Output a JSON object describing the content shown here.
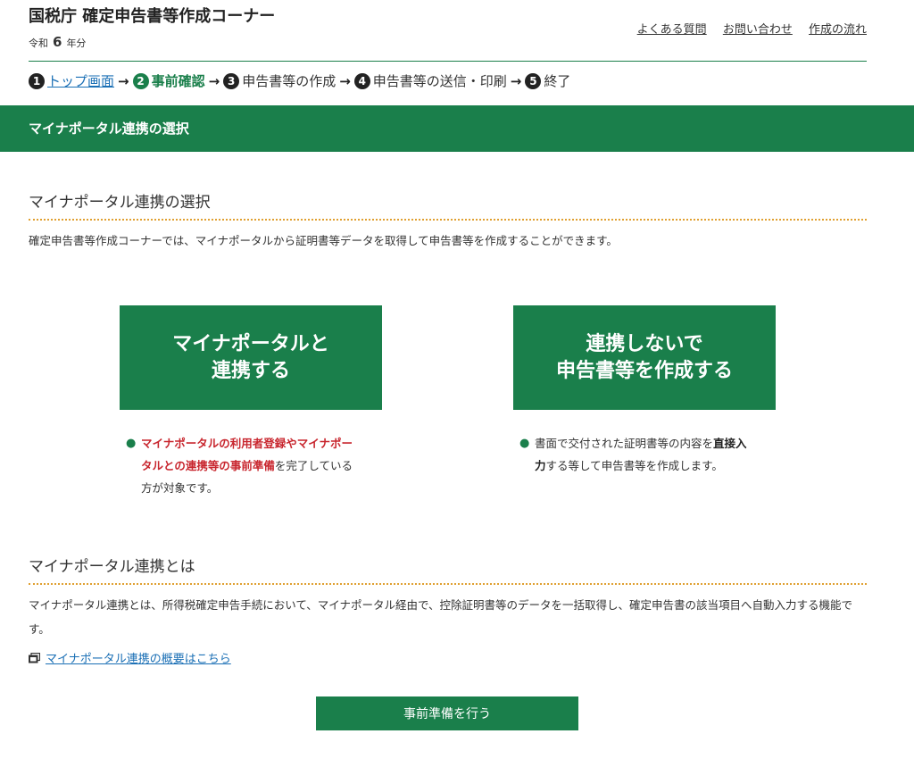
{
  "header": {
    "title": "国税庁 確定申告書等作成コーナー",
    "era_prefix": "令和",
    "era_year": "6",
    "era_suffix": "年分",
    "links": [
      "よくある質問",
      "お問い合わせ",
      "作成の流れ"
    ]
  },
  "steps": [
    {
      "num": "1",
      "label": "トップ画面"
    },
    {
      "num": "2",
      "label": "事前確認"
    },
    {
      "num": "3",
      "label": "申告書等の作成"
    },
    {
      "num": "4",
      "label": "申告書等の送信・印刷"
    },
    {
      "num": "5",
      "label": "終了"
    }
  ],
  "page_title": "マイナポータル連携の選択",
  "section1": {
    "heading": "マイナポータル連携の選択",
    "description": "確定申告書等作成コーナーでは、マイナポータルから証明書等データを取得して申告書等を作成することができます。"
  },
  "option_link": {
    "line1": "マイナポータルと",
    "line2": "連携する",
    "note_red": "マイナポータルの利用者登録やマイナポータルとの連携等の事前準備",
    "note_rest": "を完了している方が対象です。"
  },
  "option_nolink": {
    "line1": "連携しないで",
    "line2": "申告書等を作成する",
    "note_pre": "書面で交付された証明書等の内容を",
    "note_bold": "直接入力",
    "note_post": "する等して申告書等を作成します。"
  },
  "section2": {
    "heading": "マイナポータル連携とは",
    "description": "マイナポータル連携とは、所得税確定申告手続において、マイナポータル経由で、控除証明書等のデータを一括取得し、確定申告書の該当項目へ自動入力する機能です。",
    "link_text": "マイナポータル連携の概要はこちら"
  },
  "prep_button": "事前準備を行う",
  "colors": {
    "accent_green": "#1a7f4b",
    "link_blue": "#1a6fb5",
    "warning_red": "#c8262e",
    "dotted_orange": "#e0a030"
  }
}
